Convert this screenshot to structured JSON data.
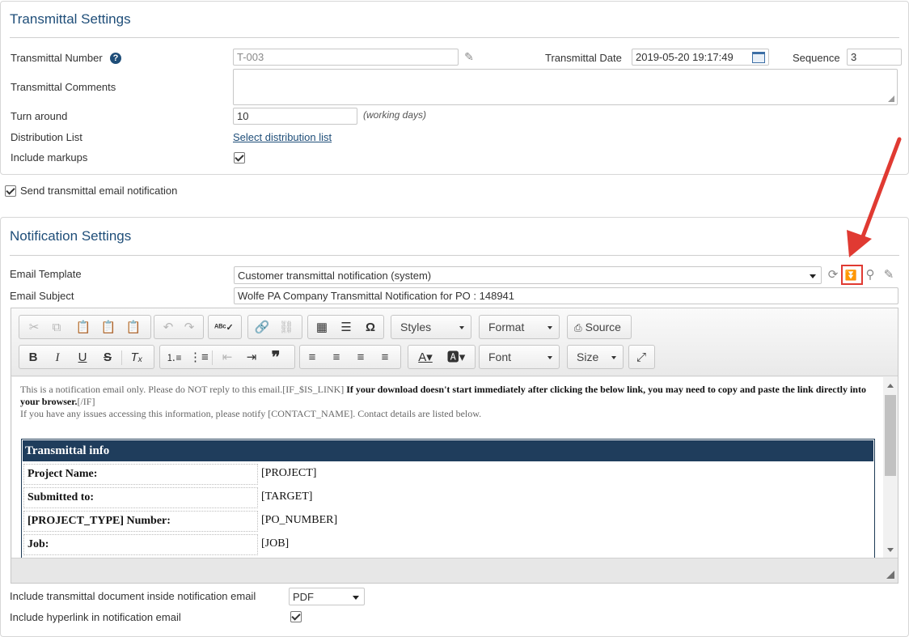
{
  "transmittal": {
    "title": "Transmittal Settings",
    "number_label": "Transmittal Number",
    "number_value": "T-003",
    "date_label": "Transmittal Date",
    "date_value": "2019-05-20 19:17:49",
    "sequence_label": "Sequence",
    "sequence_value": "3",
    "comments_label": "Transmittal Comments",
    "comments_value": "",
    "turnaround_label": "Turn around",
    "turnaround_value": "10",
    "turnaround_hint": "(working days)",
    "distribution_label": "Distribution List",
    "distribution_link": "Select distribution list",
    "markups_label": "Include markups",
    "markups_checked": true
  },
  "send_notification": {
    "label": "Send transmittal email notification",
    "checked": true
  },
  "notification": {
    "title": "Notification Settings",
    "template_label": "Email Template",
    "template_value": "Customer transmittal notification (system)",
    "subject_label": "Email Subject",
    "subject_value": "Wolfe PA Company Transmittal Notification for PO : 148941",
    "template_icons": [
      "refresh-icon",
      "expand-down-icon",
      "search-icon",
      "pencil-icon"
    ],
    "highlight_color": "#e03a32"
  },
  "editor": {
    "toolbar": {
      "styles_label": "Styles",
      "format_label": "Format",
      "source_label": "Source",
      "font_label": "Font",
      "size_label": "Size"
    },
    "body": {
      "line1_plain": "This is a notification email only. Please do NOT reply to this email.[IF_$IS_LINK] ",
      "line1_bold": "If your download doesn't start immediately after clicking the below link, you may need to copy and paste the link directly into your browser.",
      "line1_tail": "[/IF]",
      "line2": "If you have any issues accessing this information, please notify [CONTACT_NAME]. Contact details are listed below."
    },
    "table": {
      "header": "Transmittal info",
      "header_color": "#1f3d5c",
      "rows": [
        {
          "key": "Project Name:",
          "value": "[PROJECT]"
        },
        {
          "key": "Submitted to:",
          "value": "[TARGET]"
        },
        {
          "key": "[PROJECT_TYPE] Number:",
          "value": "[PO_NUMBER]"
        },
        {
          "key": "Job:",
          "value": "[JOB]"
        }
      ]
    }
  },
  "options": {
    "include_doc_label": "Include transmittal document inside notification email",
    "include_doc_value": "PDF",
    "include_link_label": "Include hyperlink in notification email",
    "include_link_checked": true
  }
}
